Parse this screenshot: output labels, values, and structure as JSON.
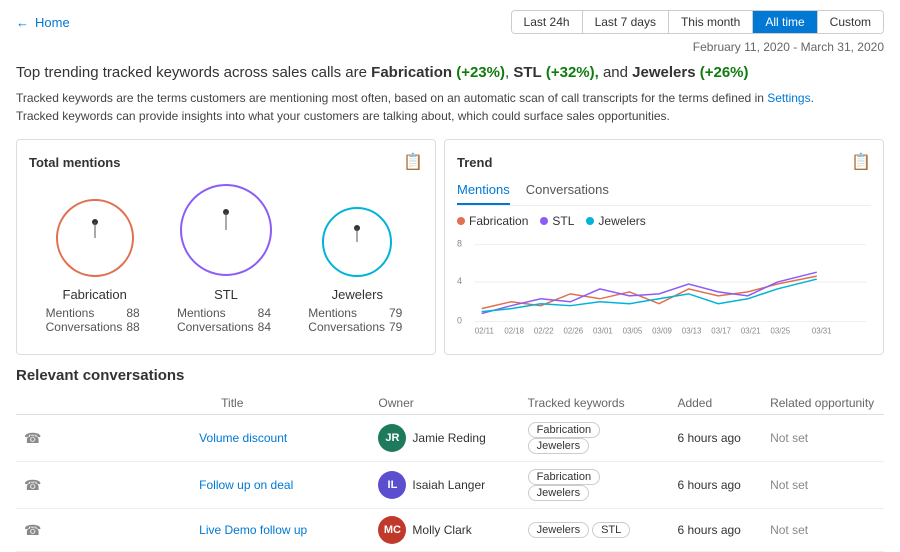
{
  "header": {
    "back_label": "Home",
    "time_filters": [
      {
        "label": "Last 24h",
        "active": false
      },
      {
        "label": "Last 7 days",
        "active": false
      },
      {
        "label": "This month",
        "active": false
      },
      {
        "label": "All time",
        "active": true
      },
      {
        "label": "Custom",
        "active": false
      }
    ],
    "date_range": "February 11, 2020 - March 31, 2020"
  },
  "main_title": {
    "prefix": "Top trending tracked keywords across sales calls are ",
    "kw1": "Fabrication",
    "kw1_pct": "(+23%)",
    "kw2": "STL",
    "kw2_pct": "(+32%),",
    "kw3": "Jewelers",
    "kw3_pct": "(+26%)"
  },
  "description": {
    "line1": "Tracked keywords are the terms customers are mentioning most often, based on an automatic scan of call transcripts for the terms defined in ",
    "settings_link": "Settings",
    "period": ".",
    "line2": "Tracked keywords can provide insights into what your customers are talking about, which could surface sales opportunities."
  },
  "total_mentions": {
    "title": "Total mentions",
    "circles": [
      {
        "label": "Fabrication",
        "color": "#e07050",
        "radius": 40,
        "mentions": 88,
        "conversations": 88
      },
      {
        "label": "STL",
        "color": "#8b5cf6",
        "radius": 48,
        "mentions": 84,
        "conversations": 84
      },
      {
        "label": "Jewelers",
        "color": "#00b4d8",
        "radius": 36,
        "mentions": 79,
        "conversations": 79
      }
    ]
  },
  "trend": {
    "title": "Trend",
    "tabs": [
      {
        "label": "Mentions",
        "active": true
      },
      {
        "label": "Conversations",
        "active": false
      }
    ],
    "legend": [
      {
        "label": "Fabrication",
        "color": "#e07050"
      },
      {
        "label": "STL",
        "color": "#8b5cf6"
      },
      {
        "label": "Jewelers",
        "color": "#00b4d8"
      }
    ],
    "y_labels": [
      "8",
      "4",
      "0"
    ],
    "x_labels": [
      "02/11",
      "02/18",
      "02/22",
      "02/26",
      "03/01",
      "03/05",
      "03/09",
      "03/13",
      "03/17",
      "03/21",
      "03/25",
      "03/31"
    ]
  },
  "conversations": {
    "section_title": "Relevant conversations",
    "columns": [
      "Title",
      "Owner",
      "Tracked keywords",
      "Added",
      "Related opportunity"
    ],
    "rows": [
      {
        "title": "Volume discount",
        "owner_name": "Jamie Reding",
        "owner_initials": "JR",
        "owner_color": "#1e7a5c",
        "keywords": [
          "Fabrication",
          "Jewelers"
        ],
        "added": "6 hours ago",
        "opportunity": "Not set"
      },
      {
        "title": "Follow up on deal",
        "owner_name": "Isaiah Langer",
        "owner_initials": "IL",
        "owner_color": "#5b4fcf",
        "keywords": [
          "Fabrication",
          "Jewelers"
        ],
        "added": "6 hours ago",
        "opportunity": "Not set"
      },
      {
        "title": "Live Demo follow up",
        "owner_name": "Molly Clark",
        "owner_initials": "MC",
        "owner_color": "#c0392b",
        "keywords": [
          "Jewelers",
          "STL"
        ],
        "added": "6 hours ago",
        "opportunity": "Not set"
      }
    ]
  }
}
